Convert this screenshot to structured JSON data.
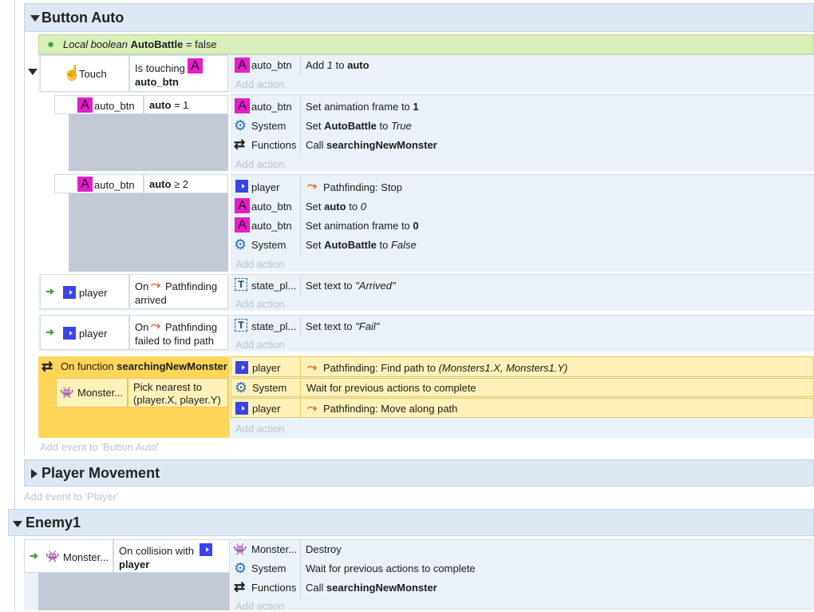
{
  "groups": {
    "button_auto": "Button Auto",
    "player_movement": "Player Movement",
    "enemy1": "Enemy1"
  },
  "local_var": {
    "prefix": "Local boolean",
    "name": "AutoBattle",
    "suffix": "= false"
  },
  "ev1": {
    "cond_touch": "Touch",
    "cond_text": "Is touching",
    "cond_obj": "auto_btn",
    "action_obj": "auto_btn",
    "action_pre": "Add",
    "action_value": "1",
    "action_mid": "to",
    "action_var": "auto",
    "add_action": "Add action"
  },
  "sub1": {
    "cond_obj": "auto_btn",
    "cond_var": "auto",
    "cond_op": "= 1",
    "actions": [
      {
        "obj": "auto_btn",
        "pre": "Set animation frame to",
        "bold": "1",
        "mid": "",
        "ital": ""
      },
      {
        "obj": "System",
        "pre": "Set",
        "bold": "AutoBattle",
        "mid": "to",
        "ital": "True"
      },
      {
        "obj": "Functions",
        "pre": "Call",
        "bold": "searchingNewMonster",
        "mid": "",
        "ital": ""
      }
    ],
    "add_action": "Add action"
  },
  "sub2": {
    "cond_obj": "auto_btn",
    "cond_var": "auto",
    "cond_op": "≥ 2",
    "actions": [
      {
        "obj": "player",
        "pre": "Pathfinding: Stop",
        "bold": "",
        "mid": "",
        "ital": ""
      },
      {
        "obj": "auto_btn",
        "pre": "Set",
        "bold": "auto",
        "mid": "to",
        "ital": "0"
      },
      {
        "obj": "auto_btn",
        "pre": "Set animation frame to",
        "bold": "0",
        "mid": "",
        "ital": ""
      },
      {
        "obj": "System",
        "pre": "Set",
        "bold": "AutoBattle",
        "mid": "to",
        "ital": "False"
      }
    ],
    "add_action": "Add action"
  },
  "sub3": {
    "cond_obj": "player",
    "cond_line1": "On",
    "cond_line1b": "Pathfinding",
    "cond_line2": "arrived",
    "action_obj": "state_pl...",
    "action_pre": "Set text to",
    "action_ital": "\"Arrived\"",
    "add_action": "Add action"
  },
  "sub4": {
    "cond_obj": "player",
    "cond_line1": "On",
    "cond_line1b": "Pathfinding",
    "cond_line2": "failed to find path",
    "action_obj": "state_pl...",
    "action_pre": "Set text to",
    "action_ital": "\"Fail\"",
    "add_action": "Add action"
  },
  "sub5": {
    "func_pre": "On function",
    "func_name": "searchingNewMonster",
    "pick_obj": "Monster...",
    "pick_line1": "Pick nearest to",
    "pick_line2": "(player.X, player.Y)",
    "actions": [
      {
        "obj": "player",
        "text": "Pathfinding: Find path to",
        "ital": "(Monsters1.X, Monsters1.Y)"
      },
      {
        "obj": "System",
        "text": "Wait for previous actions to complete",
        "ital": ""
      },
      {
        "obj": "player",
        "text": "Pathfinding: Move along path",
        "ital": ""
      }
    ],
    "add_action": "Add action"
  },
  "add_event_button_auto": "Add event to 'Button Auto'",
  "add_event_player": "Add event to 'Player'",
  "enemy_event": {
    "cond_obj": "Monster...",
    "cond_line1": "On collision with",
    "cond_line2": "player",
    "actions": [
      {
        "obj": "Monster...",
        "pre": "Destroy",
        "bold": ""
      },
      {
        "obj": "System",
        "pre": "Wait for previous actions to complete",
        "bold": ""
      },
      {
        "obj": "Functions",
        "pre": "Call",
        "bold": "searchingNewMonster"
      }
    ],
    "add_action": "Add action"
  },
  "colors": {
    "group_header": "#dde8f4",
    "event_bg": "#ebf1f8",
    "local_var_bg": "#d9efb9",
    "function_yellow": "#ffd65a",
    "action_yellow": "#fff1b8",
    "sprite_pink": "#e41ec8",
    "player_blue": "#3a44e8",
    "add_text": "#b9c4d0"
  },
  "icons": {
    "sprite": "A",
    "system": "gear-icon",
    "functions": "loop-arrows-icon",
    "text_object": "T",
    "pathfinding": "pathfinding-icon",
    "monster": "monster-icon",
    "trigger": "arrow-right-icon",
    "touch": "hand-touch-icon",
    "pin": "map-pin-icon"
  }
}
